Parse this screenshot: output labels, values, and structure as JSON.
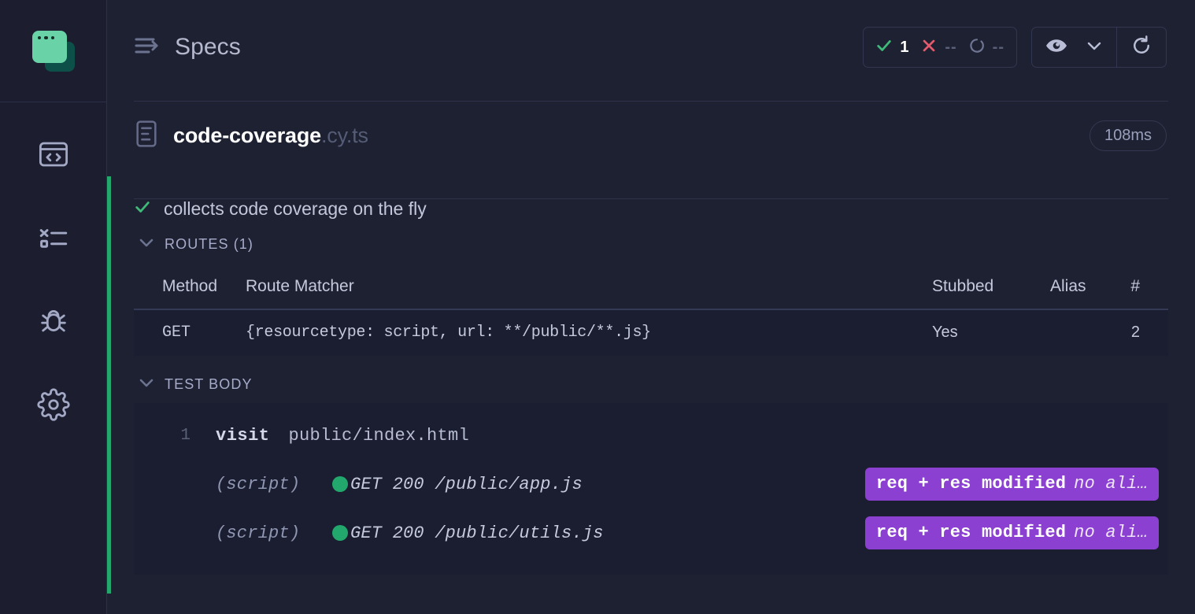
{
  "sidebar": {
    "logo_name": "cypress-logo",
    "items": [
      {
        "name": "specs-browser-icon",
        "label": "Specs"
      },
      {
        "name": "test-results-icon",
        "label": "Runs"
      },
      {
        "name": "debug-bug-icon",
        "label": "Debug"
      },
      {
        "name": "settings-gear-icon",
        "label": "Settings"
      }
    ]
  },
  "header": {
    "title": "Specs",
    "stats": [
      {
        "icon": "check-icon",
        "value": "1",
        "state": "passed"
      },
      {
        "icon": "x-icon",
        "value": "--",
        "state": "failed"
      },
      {
        "icon": "pending-icon",
        "value": "--",
        "state": "pending"
      }
    ],
    "preview_button": "eye-icon",
    "chevron_button": "chevron-down-icon",
    "refresh_button": "refresh-icon"
  },
  "spec": {
    "file_base": "code-coverage",
    "file_ext": ".cy.ts",
    "duration": "108ms"
  },
  "test": {
    "status": "passed",
    "title": "collects code coverage on the fly",
    "routes_section_label": "ROUTES (1)",
    "test_body_section_label": "TEST BODY"
  },
  "routes_table": {
    "columns": [
      "Method",
      "Route Matcher",
      "Stubbed",
      "Alias",
      "#"
    ],
    "rows": [
      {
        "method": "GET",
        "matcher": "{resourcetype: script, url: **/public/**.js}",
        "stubbed": "Yes",
        "alias": "",
        "count": "2"
      }
    ]
  },
  "test_body": {
    "command": {
      "line_no": "1",
      "name": "visit",
      "arg": "public/index.html"
    },
    "xhrs": [
      {
        "type": "(script)",
        "text": "GET 200 /public/app.js",
        "status": "success",
        "badge_main": "req + res modified",
        "badge_alias": "no ali…"
      },
      {
        "type": "(script)",
        "text": "GET 200 /public/utils.js",
        "status": "success",
        "badge_main": "req + res modified",
        "badge_alias": "no ali…"
      }
    ]
  },
  "colors": {
    "background": "#1e2132",
    "panel": "#1b1e30",
    "accent_green": "#22a86c",
    "accent_purple": "#8b40d2",
    "fail_red": "#e45b6d",
    "text": "#c5c9dc",
    "muted": "#5b6079"
  }
}
